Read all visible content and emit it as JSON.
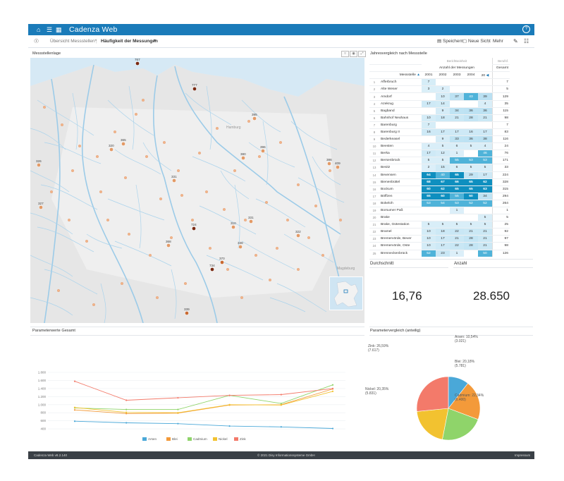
{
  "app": {
    "title": "Cadenza Web",
    "help_icon": "help-circle-icon"
  },
  "subbar": {
    "breadcrumb_1": "Übersicht Messstellen*",
    "breadcrumb_2": "Häufigkeit der Messungen",
    "save": "Speichern",
    "new_view": "Neue Sicht",
    "more": "Mehr"
  },
  "map": {
    "title": "Messstellenlage",
    "city_hamburg": "Hamburg",
    "city_magdeburg": "Magdeburg",
    "markers": [
      {
        "label": "767",
        "color": "#7a2a12"
      },
      {
        "label": "777",
        "color": "#7a2a12"
      },
      {
        "label": "395",
        "color": "#e39a66"
      },
      {
        "label": "320",
        "color": "#e39a66"
      },
      {
        "label": "365",
        "color": "#e39a66"
      },
      {
        "label": "326",
        "color": "#e39a66"
      },
      {
        "label": "380",
        "color": "#e39a66"
      },
      {
        "label": "396",
        "color": "#e39a66"
      },
      {
        "label": "386",
        "color": "#e39a66"
      },
      {
        "label": "409",
        "color": "#e39a66"
      },
      {
        "label": "331",
        "color": "#e39a66"
      },
      {
        "label": "327",
        "color": "#e39a66"
      },
      {
        "label": "724",
        "color": "#7a2a12"
      },
      {
        "label": "310",
        "color": "#e39a66"
      },
      {
        "label": "331",
        "color": "#e39a66"
      },
      {
        "label": "322",
        "color": "#e39a66"
      },
      {
        "label": "368",
        "color": "#e39a66"
      },
      {
        "label": "338",
        "color": "#e39a66"
      },
      {
        "label": "370",
        "color": "#c96a32"
      },
      {
        "label": "734",
        "color": "#7a2a12"
      },
      {
        "label": "339",
        "color": "#c96a32"
      }
    ]
  },
  "table": {
    "title": "Jahresvergleich nach Messstelle",
    "top_label": "Berichtseinheit",
    "group_label": "Anzahl der Messungen",
    "col_name": "Messstelle",
    "years": [
      "2001",
      "2002",
      "2003",
      "2004",
      "20"
    ],
    "total_top": "Berufsf.",
    "total_label": "Gesamt",
    "rows": [
      {
        "n": "1",
        "name": "Afferbruch",
        "v": [
          "7",
          "",
          "",
          "",
          ""
        ],
        "t": "7"
      },
      {
        "n": "2",
        "name": "Alte Weser",
        "v": [
          "3",
          "2",
          "",
          "",
          ""
        ],
        "t": "5"
      },
      {
        "n": "3",
        "name": "Amdorf",
        "v": [
          "",
          "10",
          "37",
          "43",
          "39"
        ],
        "t": "129"
      },
      {
        "n": "4",
        "name": "Azekrug",
        "v": [
          "17",
          "14",
          "",
          "",
          "4"
        ],
        "t": "35"
      },
      {
        "n": "5",
        "name": "Bagband",
        "v": [
          "",
          "9",
          "34",
          "36",
          "36"
        ],
        "t": "115"
      },
      {
        "n": "6",
        "name": "Bahnhof Neuhaus",
        "v": [
          "10",
          "18",
          "21",
          "28",
          "21"
        ],
        "t": "98"
      },
      {
        "n": "7",
        "name": "Barenburg",
        "v": [
          "7",
          "",
          "",
          "",
          ""
        ],
        "t": "7"
      },
      {
        "n": "8",
        "name": "Barenburg II",
        "v": [
          "16",
          "17",
          "17",
          "16",
          "17"
        ],
        "t": "83"
      },
      {
        "n": "9",
        "name": "Bederkeasel",
        "v": [
          "",
          "9",
          "33",
          "36",
          "38"
        ],
        "t": "116"
      },
      {
        "n": "10",
        "name": "Beesten",
        "v": [
          "4",
          "5",
          "6",
          "5",
          "4"
        ],
        "t": "24"
      },
      {
        "n": "11",
        "name": "Berka",
        "v": [
          "17",
          "12",
          "1",
          "",
          "46"
        ],
        "t": "76"
      },
      {
        "n": "12",
        "name": "Bersenbrück",
        "v": [
          "5",
          "5",
          "55",
          "53",
          "53"
        ],
        "t": "171"
      },
      {
        "n": "13",
        "name": "Besitz",
        "v": [
          "2",
          "15",
          "6",
          "5",
          "5"
        ],
        "t": "33"
      },
      {
        "n": "14",
        "name": "Bevensen",
        "v": [
          "64",
          "40",
          "65",
          "29",
          "17"
        ],
        "t": "224"
      },
      {
        "n": "15",
        "name": "Bienenbüttel",
        "v": [
          "68",
          "67",
          "66",
          "65",
          "62"
        ],
        "t": "328"
      },
      {
        "n": "16",
        "name": "Bockum",
        "v": [
          "60",
          "62",
          "65",
          "65",
          "63"
        ],
        "t": "315"
      },
      {
        "n": "17",
        "name": "Böffzen",
        "v": [
          "65",
          "60",
          "55",
          "60",
          "34"
        ],
        "t": "294"
      },
      {
        "n": "18",
        "name": "Bokeloh",
        "v": [
          "53",
          "54",
          "53",
          "52",
          "52"
        ],
        "t": "264"
      },
      {
        "n": "19",
        "name": "Borsumer Paß",
        "v": [
          "",
          "",
          "1",
          "",
          ""
        ],
        "t": "1"
      },
      {
        "n": "20",
        "name": "Brake",
        "v": [
          "",
          "",
          "",
          "",
          "5"
        ],
        "t": "5"
      },
      {
        "n": "21",
        "name": "Brake, Gütestation",
        "v": [
          "5",
          "5",
          "5",
          "5",
          "5"
        ],
        "t": "25"
      },
      {
        "n": "22",
        "name": "Bramel",
        "v": [
          "10",
          "18",
          "22",
          "21",
          "21"
        ],
        "t": "92"
      },
      {
        "n": "23",
        "name": "Bremervörde, Bever",
        "v": [
          "10",
          "17",
          "21",
          "28",
          "21"
        ],
        "t": "97"
      },
      {
        "n": "24",
        "name": "Bremervörde, Oste",
        "v": [
          "10",
          "17",
          "22",
          "28",
          "21"
        ],
        "t": "98"
      },
      {
        "n": "25",
        "name": "Brenneckenbrück",
        "v": [
          "52",
          "23",
          "1",
          "",
          "50"
        ],
        "t": "126"
      },
      {
        "n": "26",
        "name": "Brockstedt",
        "v": [
          "",
          "",
          "1",
          "",
          "44"
        ],
        "t": "45"
      },
      {
        "n": "27",
        "name": "Brokdorf",
        "v": [
          "6",
          "",
          "",
          "",
          ""
        ],
        "t": "6"
      }
    ]
  },
  "kpi": {
    "avg_label": "Durchschnitt",
    "avg_value": "16,76",
    "count_label": "Anzahl",
    "count_value": "28.650"
  },
  "line_panel": {
    "title": "Parameterwerte Gesamt"
  },
  "pie_panel": {
    "title": "Parametervergleich (anteilig)"
  },
  "chart_data": [
    {
      "type": "line",
      "title": "Parameterwerte Gesamt",
      "x": [
        "2.000",
        "2.001",
        "2.002",
        "2.003",
        "2.004",
        "2.005"
      ],
      "yticks": [
        "0",
        "200",
        "400",
        "600",
        "800",
        "1.000",
        "1.200",
        "1.400",
        "1.600",
        "1.800"
      ],
      "ylim": [
        0,
        1800
      ],
      "grid": true,
      "legend": "bottom",
      "series": [
        {
          "name": "Arsen",
          "color": "#4aa8d8",
          "values": [
            590,
            550,
            530,
            470,
            450,
            410
          ]
        },
        {
          "name": "Blei",
          "color": "#f39a3a",
          "values": [
            870,
            780,
            790,
            990,
            1000,
            1390
          ]
        },
        {
          "name": "Cadmium",
          "color": "#8fd46a",
          "values": [
            920,
            880,
            880,
            1230,
            1030,
            1490
          ]
        },
        {
          "name": "Nickel",
          "color": "#f2c230",
          "values": [
            930,
            810,
            800,
            1000,
            990,
            1330
          ]
        },
        {
          "name": "Zink",
          "color": "#f37a6a",
          "values": [
            1580,
            1110,
            1170,
            1230,
            1250,
            1400
          ]
        }
      ]
    },
    {
      "type": "pie",
      "title": "Parametervergleich (anteilig)",
      "legend": "labels",
      "series": [
        {
          "name": "Arsen",
          "pct": "10,54%",
          "count": "(3.021)",
          "value": 3021,
          "color": "#4aa8d8"
        },
        {
          "name": "Blei",
          "pct": "20,18%",
          "count": "(5.781)",
          "value": 5781,
          "color": "#f39a3a"
        },
        {
          "name": "Cadmium",
          "pct": "22,34%",
          "count": "(6.400)",
          "value": 6400,
          "color": "#8fd46a"
        },
        {
          "name": "Nickel",
          "pct": "20,35%",
          "count": "(5.831)",
          "value": 5831,
          "color": "#f2c230"
        },
        {
          "name": "Zink",
          "pct": "26,59%",
          "count": "(7.617)",
          "value": 7617,
          "color": "#f37a6a"
        }
      ]
    }
  ],
  "footer": {
    "version": "Cadenza Web v8.2.140",
    "copyright": "© 2021 Disy Informationssysteme GmbH",
    "imprint": "Impressum"
  }
}
